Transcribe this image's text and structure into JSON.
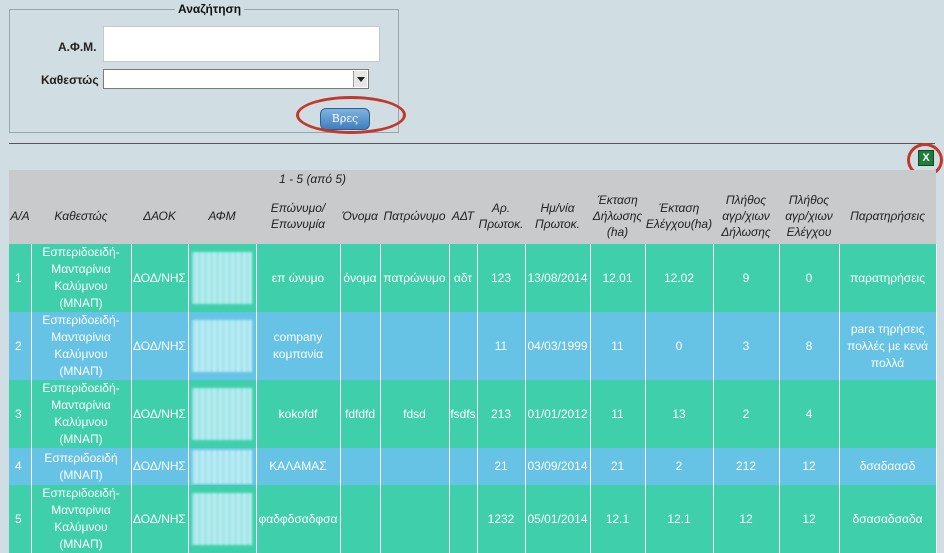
{
  "search": {
    "legend": "Αναζήτηση",
    "afm_label": "Α.Φ.Μ.",
    "afm_value": "",
    "status_label": "Καθεστώς",
    "status_value": "",
    "button_label": "Βρες"
  },
  "table": {
    "pager": "1 - 5 (από 5)",
    "headers": [
      "Α/Α",
      "Καθεστώς",
      "ΔΑΟΚ",
      "ΑΦΜ",
      "Επώνυμο/ Επωνυμία",
      "Όνομα",
      "Πατρώνυμο",
      "ΑΔΤ",
      "Αρ. Πρωτοκ.",
      "Ημ/νία Πρωτοκ.",
      "Έκταση Δήλωσης (ha)",
      "Έκταση Ελέγχου(ha)",
      "Πλήθος αγρ/χιων Δήλωσης",
      "Πλήθος αγρ/χιων Ελέγχου",
      "Παρατηρήσεις"
    ],
    "rows": [
      {
        "aa": "1",
        "status": "Εσπεριδοειδή- Μανταρίνια Καλύμνου (ΜΝΑΠ)",
        "daok": "ΔΟΔ/ΝΗΣ",
        "afm": "",
        "surname": "επ ώνυμο",
        "name": "όνομα",
        "father": "πατρώνυμο",
        "adt": "αδτ",
        "protocol": "123",
        "date": "13/08/2014",
        "area_decl": "12.01",
        "area_check": "12.02",
        "fields_decl": "9",
        "fields_check": "0",
        "notes": "παρατηρήσεις"
      },
      {
        "aa": "2",
        "status": "Εσπεριδοειδή- Μανταρίνια Καλύμνου (ΜΝΑΠ)",
        "daok": "ΔΟΔ/ΝΗΣ",
        "afm": "",
        "surname": "company κομπανία",
        "name": "",
        "father": "",
        "adt": "",
        "protocol": "11",
        "date": "04/03/1999",
        "area_decl": "11",
        "area_check": "0",
        "fields_decl": "3",
        "fields_check": "8",
        "notes": "para τηρήσεις πολλές με κενά πολλά"
      },
      {
        "aa": "3",
        "status": "Εσπεριδοειδή- Μανταρίνια Καλύμνου (ΜΝΑΠ)",
        "daok": "ΔΟΔ/ΝΗΣ",
        "afm": "",
        "surname": "kokofdf",
        "name": "fdfdfd",
        "father": "fdsd",
        "adt": "fsdfs",
        "protocol": "213",
        "date": "01/01/2012",
        "area_decl": "11",
        "area_check": "13",
        "fields_decl": "2",
        "fields_check": "4",
        "notes": ""
      },
      {
        "aa": "4",
        "status": "Εσπεριδοειδή (ΜΝΑΠ)",
        "daok": "ΔΟΔ/ΝΗΣ",
        "afm": "",
        "surname": "ΚΑΛΑΜΑΣ",
        "name": "",
        "father": "",
        "adt": "",
        "protocol": "21",
        "date": "03/09/2014",
        "area_decl": "21",
        "area_check": "2",
        "fields_decl": "212",
        "fields_check": "12",
        "notes": "δσαδαασδ"
      },
      {
        "aa": "5",
        "status": "Εσπεριδοειδή- Μανταρίνια Καλύμνου (ΜΝΑΠ)",
        "daok": "ΔΟΔ/ΝΗΣ",
        "afm": "",
        "surname": "φαδφδσαδφσα",
        "name": "",
        "father": "",
        "adt": "",
        "protocol": "1232",
        "date": "05/01/2014",
        "area_decl": "12.1",
        "area_check": "12.1",
        "fields_decl": "12",
        "fields_check": "12",
        "notes": "δσασαδσαδα"
      }
    ]
  },
  "icons": {
    "export": "excel-export-icon"
  },
  "colors": {
    "row_green": "#3fcfaa",
    "row_blue": "#66c3e6",
    "header_gray": "#c8cacc",
    "highlight_ring": "#c0392b"
  }
}
